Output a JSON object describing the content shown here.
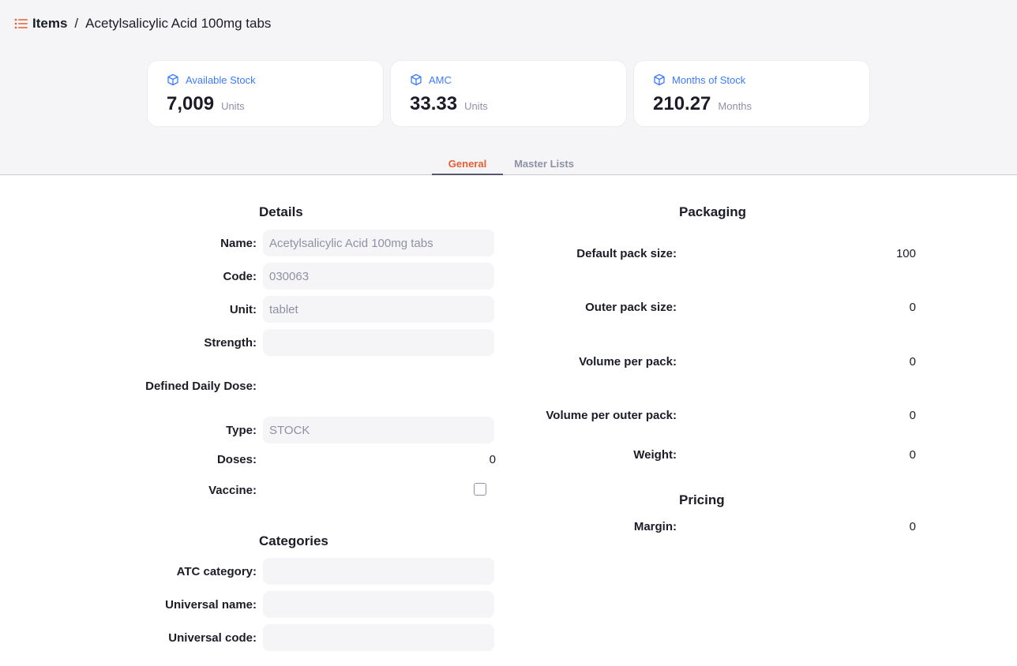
{
  "breadcrumb": {
    "root": "Items",
    "separator": "/",
    "current": "Acetylsalicylic Acid 100mg tabs"
  },
  "stats": [
    {
      "label": "Available Stock",
      "value": "7,009",
      "unit": "Units",
      "icon": "box-icon"
    },
    {
      "label": "AMC",
      "value": "33.33",
      "unit": "Units",
      "icon": "box-icon"
    },
    {
      "label": "Months of Stock",
      "value": "210.27",
      "unit": "Months",
      "icon": "box-icon"
    }
  ],
  "tabs": [
    {
      "label": "General",
      "active": true
    },
    {
      "label": "Master Lists",
      "active": false
    }
  ],
  "details": {
    "title": "Details",
    "name_label": "Name:",
    "name_value": "Acetylsalicylic Acid 100mg tabs",
    "code_label": "Code:",
    "code_value": "030063",
    "unit_label": "Unit:",
    "unit_value": "tablet",
    "strength_label": "Strength:",
    "strength_value": "",
    "ddd_label": "Defined Daily Dose:",
    "type_label": "Type:",
    "type_value": "STOCK",
    "doses_label": "Doses:",
    "doses_value": "0",
    "vaccine_label": "Vaccine:",
    "vaccine_checked": false
  },
  "categories": {
    "title": "Categories",
    "atc_label": "ATC category:",
    "atc_value": "",
    "universal_name_label": "Universal name:",
    "universal_name_value": "",
    "universal_code_label": "Universal code:",
    "universal_code_value": ""
  },
  "packaging": {
    "title": "Packaging",
    "default_pack_label": "Default pack size:",
    "default_pack_value": "100",
    "outer_pack_label": "Outer pack size:",
    "outer_pack_value": "0",
    "volume_pack_label": "Volume per pack:",
    "volume_pack_value": "0",
    "volume_outer_label": "Volume per outer pack:",
    "volume_outer_value": "0",
    "weight_label": "Weight:",
    "weight_value": "0"
  },
  "pricing": {
    "title": "Pricing",
    "margin_label": "Margin:",
    "margin_value": "0"
  },
  "colors": {
    "accent": "#e95c30",
    "link": "#3e7bfa",
    "muted": "#8f90a6"
  }
}
